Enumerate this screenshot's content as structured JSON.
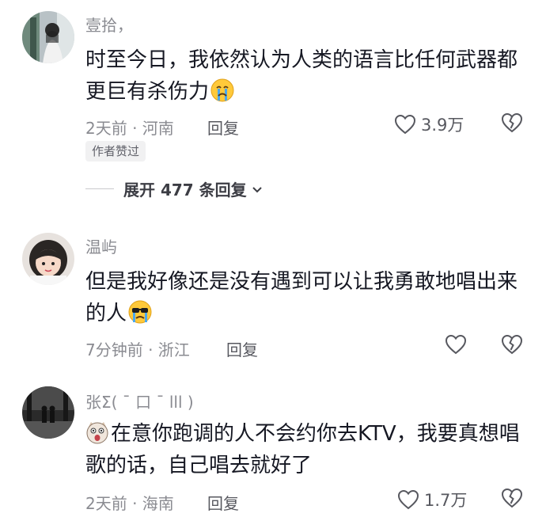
{
  "comments": [
    {
      "username": "壹拾，",
      "text": "时至今日，我依然认为人类的语言比任何武器都更巨有杀伤力",
      "emoji": "crying-face-emoji",
      "meta": "2天前 · 河南",
      "reply_label": "回复",
      "likes": "3.9万",
      "badge": "作者赞过",
      "expand_label": "展开 477 条回复"
    },
    {
      "username": "温屿",
      "text": "但是我好像还是没有遇到可以让我勇敢地唱出来的人",
      "emoji": "crying-sunglasses-emoji",
      "meta": "7分钟前 · 浙江",
      "reply_label": "回复"
    },
    {
      "username": "张Σ( ¯ 口 ¯ lll )",
      "prefix_emoji": "shocked-cat-emoji",
      "text": "在意你跑调的人不会约你去KTV，我要真想唱歌的话，自己唱去就好了",
      "meta": "2天前 · 海南",
      "reply_label": "回复",
      "likes": "1.7万"
    }
  ],
  "colors": {
    "text": "#161823",
    "secondary": "#8a8b91",
    "badge_bg": "#f1f1f2"
  }
}
